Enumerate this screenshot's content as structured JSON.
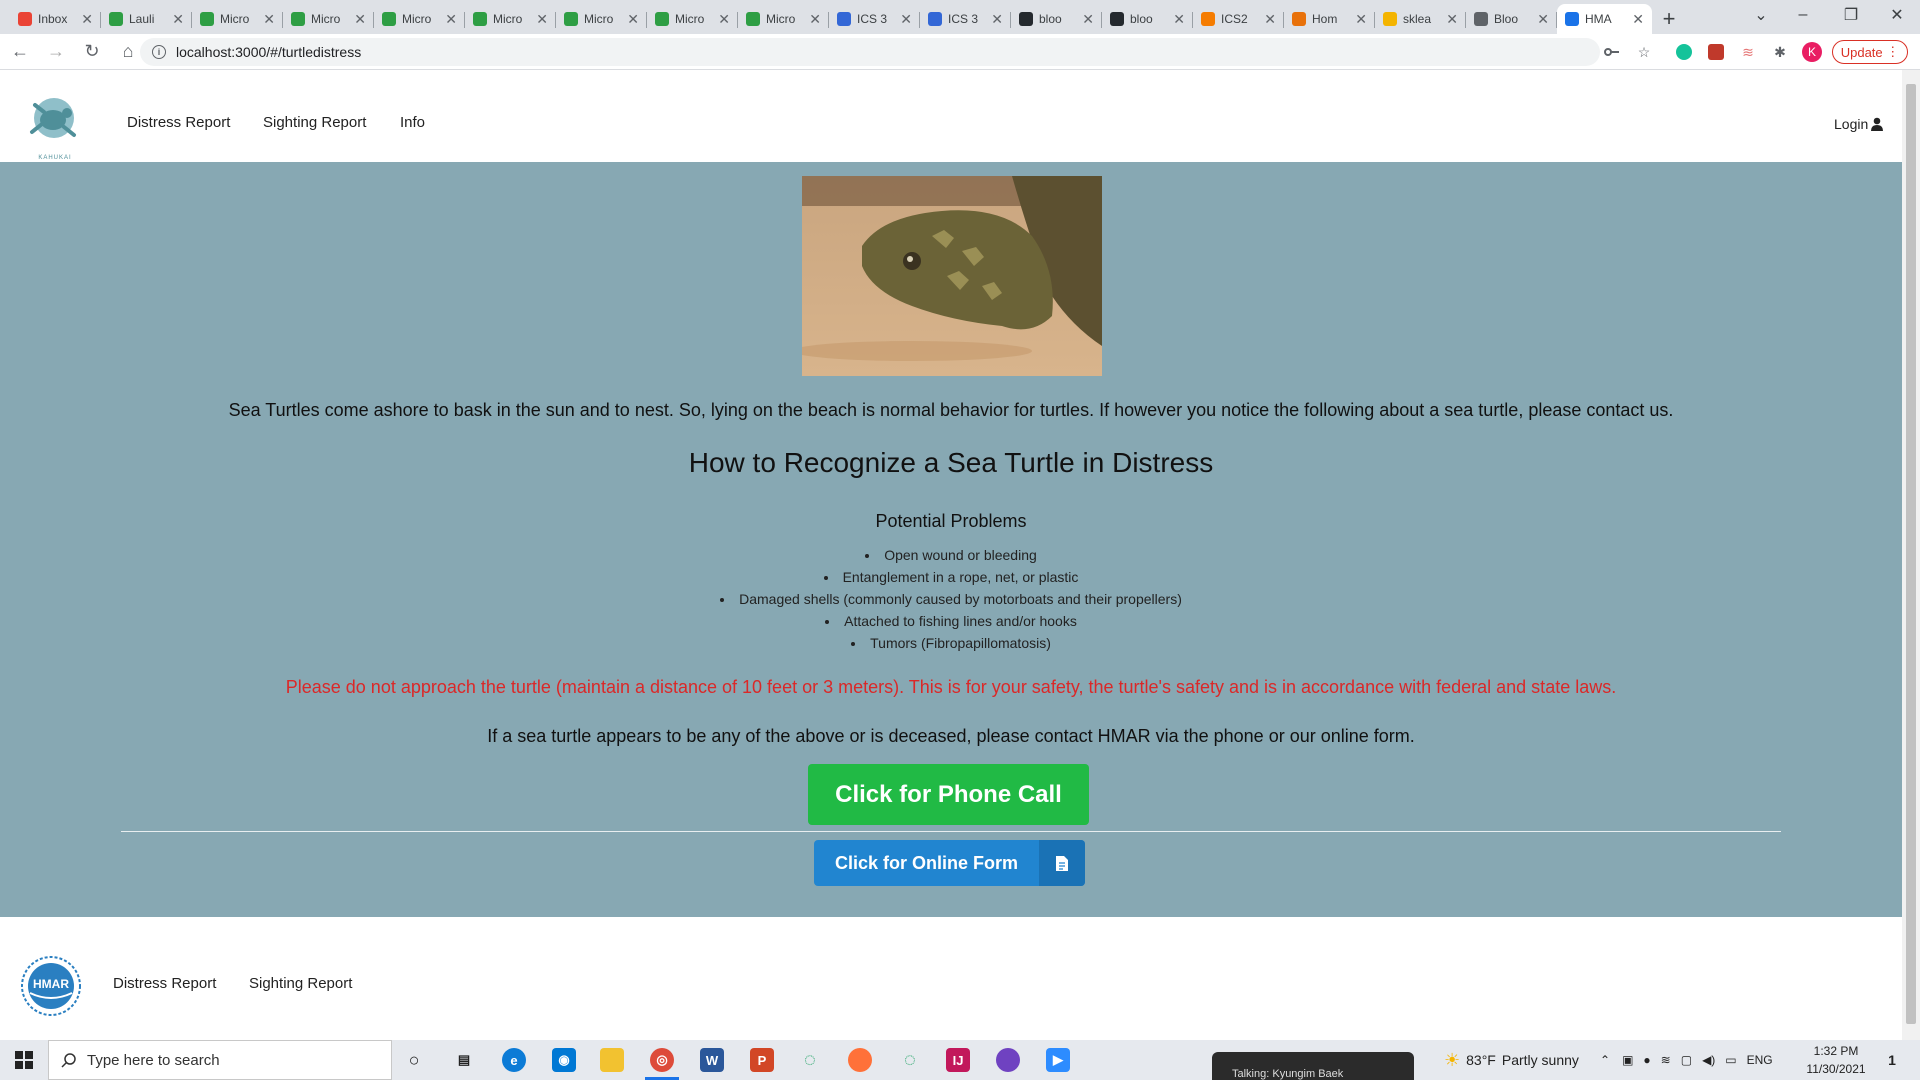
{
  "browser": {
    "tabs": [
      {
        "title": "Inbox",
        "favicon": "gmail-icon",
        "color": "#ea4335"
      },
      {
        "title": "Lauli",
        "favicon": "leaf-icon",
        "color": "#2e9e44"
      },
      {
        "title": "Micro",
        "favicon": "leaf-icon",
        "color": "#2e9e44"
      },
      {
        "title": "Micro",
        "favicon": "leaf-icon",
        "color": "#2e9e44"
      },
      {
        "title": "Micro",
        "favicon": "leaf-icon",
        "color": "#2e9e44"
      },
      {
        "title": "Micro",
        "favicon": "leaf-icon",
        "color": "#2e9e44"
      },
      {
        "title": "Micro",
        "favicon": "leaf-icon",
        "color": "#2e9e44"
      },
      {
        "title": "Micro",
        "favicon": "leaf-icon",
        "color": "#2e9e44"
      },
      {
        "title": "Micro",
        "favicon": "leaf-icon",
        "color": "#2e9e44"
      },
      {
        "title": "ICS 3",
        "favicon": "doc-icon",
        "color": "#3367d6"
      },
      {
        "title": "ICS 3",
        "favicon": "doc-icon",
        "color": "#3367d6"
      },
      {
        "title": "bloo",
        "favicon": "github-icon",
        "color": "#24292e"
      },
      {
        "title": "bloo",
        "favicon": "github-icon",
        "color": "#24292e"
      },
      {
        "title": "ICS2",
        "favicon": "ring-icon",
        "color": "#f57c00"
      },
      {
        "title": "Hom",
        "favicon": "book-icon",
        "color": "#e8710a"
      },
      {
        "title": "sklea",
        "favicon": "chart-icon",
        "color": "#f4b400"
      },
      {
        "title": "Bloo",
        "favicon": "globe-icon",
        "color": "#5f6368"
      }
    ],
    "active_tab": {
      "title": "HMA",
      "favicon": "hmar-icon",
      "color": "#1a73e8"
    },
    "url": "localhost:3000/#/turtledistress",
    "profile_initial": "K",
    "update_label": "Update"
  },
  "header": {
    "nav": [
      "Distress Report",
      "Sighting Report",
      "Info"
    ],
    "login_label": "Login",
    "logo_caption": "KAHUKAI"
  },
  "main": {
    "intro": "Sea Turtles come ashore to bask in the sun and to nest. So, lying on the beach is normal behavior for turtles. If however you notice the following about a sea turtle, please contact us.",
    "heading": "How to Recognize a Sea Turtle in Distress",
    "subheading": "Potential Problems",
    "problems": [
      "Open wound or bleeding",
      "Entanglement in a rope, net, or plastic",
      "Damaged shells (commonly caused by motorboats and their propellers)",
      "Attached to fishing lines and/or hooks",
      "Tumors (Fibropapillomatosis)"
    ],
    "warning": "Please do not approach the turtle (maintain a distance of 10 feet or 3 meters). This is for your safety, the turtle's safety and is in accordance with federal and state laws.",
    "contact": "If a sea turtle appears to be any of the above or is deceased, please contact HMAR via the phone or our online form.",
    "phone_button": "Click for Phone Call",
    "form_button": "Click for Online Form",
    "colors": {
      "background": "#87a8b3",
      "phone": "#21ba45",
      "form": "#2185d0",
      "warning": "#db2828"
    }
  },
  "footer": {
    "logo_text": "HMAR",
    "nav": [
      "Distress Report",
      "Sighting Report"
    ]
  },
  "taskbar": {
    "search_placeholder": "Type here to search",
    "teams_popup": "Talking: Kyungim Baek",
    "weather": {
      "temp": "83°F",
      "condition": "Partly sunny"
    },
    "language": "ENG",
    "time": "1:32 PM",
    "date": "11/30/2021",
    "notification_count": "1"
  }
}
